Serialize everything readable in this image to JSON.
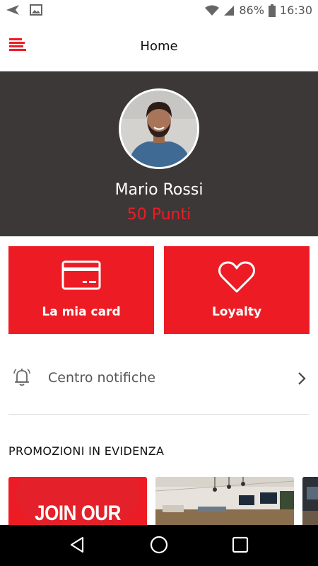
{
  "status_bar": {
    "battery_percent": "86%",
    "time": "16:30",
    "icons": [
      "send-icon",
      "image-icon",
      "wifi-icon",
      "signal-icon",
      "battery-icon"
    ]
  },
  "app_bar": {
    "title": "Home",
    "menu_icon": "menu-icon"
  },
  "profile": {
    "name": "Mario Rossi",
    "points": "50 Punti"
  },
  "tiles": [
    {
      "label": "La mia card",
      "icon": "credit-card-icon"
    },
    {
      "label": "Loyalty",
      "icon": "heart-icon"
    }
  ],
  "notifications": {
    "label": "Centro notifiche",
    "icon": "bell-icon"
  },
  "promotions": {
    "title": "PROMOZIONI IN EVIDENZA",
    "items": [
      {
        "text": "JOIN OUR TEAM"
      }
    ]
  },
  "nav_bar": {
    "icons": [
      "back-icon",
      "home-icon",
      "recents-icon"
    ]
  },
  "colors": {
    "accent": "#ed1c24",
    "profile_bg": "#3d3838",
    "nav_bg": "#000000"
  }
}
